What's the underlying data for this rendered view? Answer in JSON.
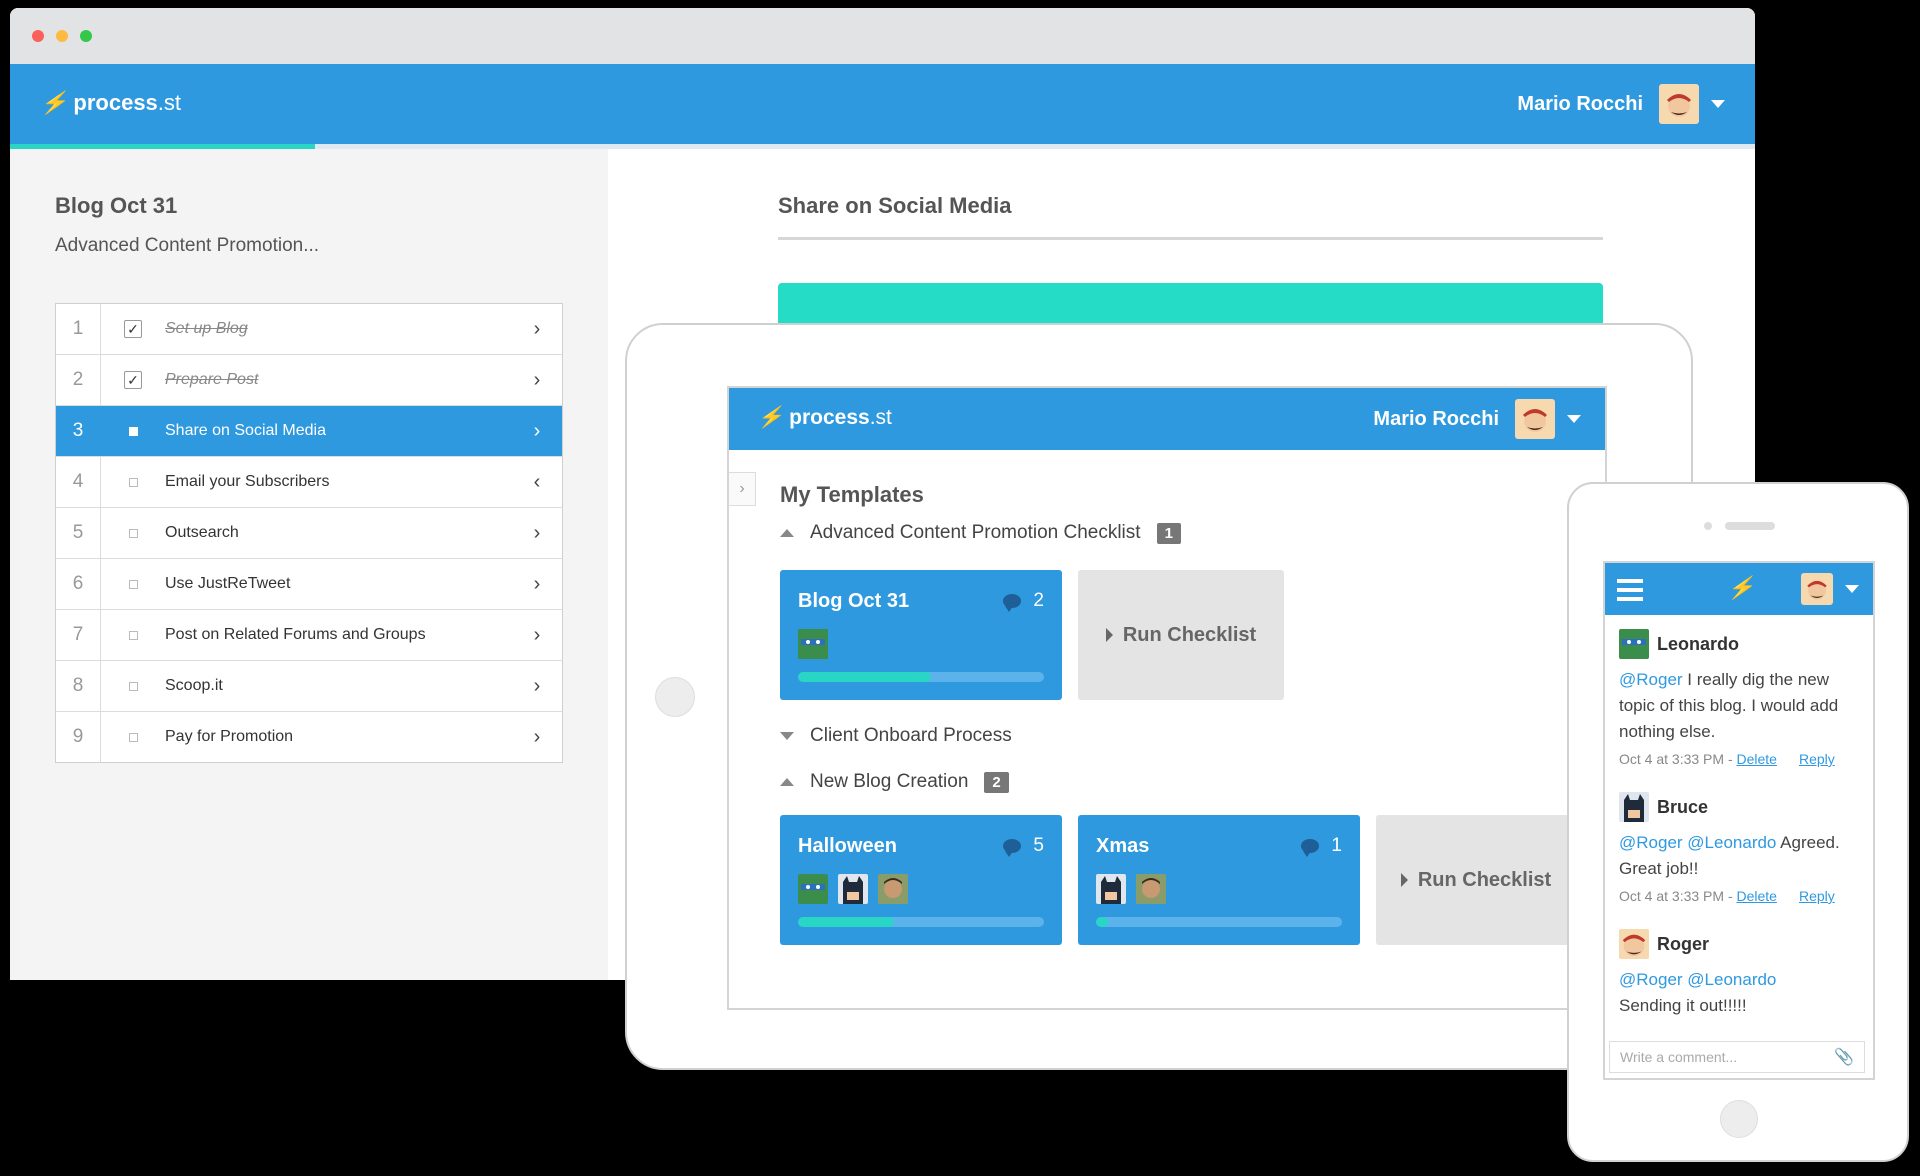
{
  "colors": {
    "brand_blue": "#2f99e0",
    "teal": "#29d6c5",
    "background": "#000000"
  },
  "brand": {
    "logo_icon": "process-street-bolt-icon",
    "name": "process",
    "tld": ".st"
  },
  "user": {
    "name": "Mario Rocchi",
    "avatar_icon": "mario-avatar-icon"
  },
  "desktop": {
    "progress": 0.175,
    "checklist_title": "Blog Oct 31",
    "checklist_subtitle": "Advanced Content Promotion...",
    "tasks": [
      {
        "num": "1",
        "label": "Set up Blog",
        "done": true
      },
      {
        "num": "2",
        "label": "Prepare Post",
        "done": true
      },
      {
        "num": "3",
        "label": "Share on Social Media",
        "active": true
      },
      {
        "num": "4",
        "label": "Email your Subscribers"
      },
      {
        "num": "5",
        "label": "Outsearch"
      },
      {
        "num": "6",
        "label": "Use JustReTweet"
      },
      {
        "num": "7",
        "label": "Post on Related Forums and Groups"
      },
      {
        "num": "8",
        "label": "Scoop.it"
      },
      {
        "num": "9",
        "label": "Pay for Promotion"
      }
    ],
    "task_heading": "Share on Social Media"
  },
  "tablet": {
    "section_title": "My Templates",
    "groups": [
      {
        "name": "Advanced Content Promotion Checklist",
        "count": "1"
      },
      {
        "name": "Client Onboard Process"
      },
      {
        "name": "New Blog Creation",
        "count": "2"
      }
    ],
    "cards": [
      {
        "title": "Blog Oct 31",
        "comments": "2",
        "progress": 0.54
      },
      {
        "title": "Halloween",
        "comments": "5",
        "progress": 0.39
      },
      {
        "title": "Xmas",
        "comments": "1",
        "progress": 0.05
      }
    ],
    "run_checklist": "Run Checklist"
  },
  "phone": {
    "comments": [
      {
        "author": "Leonardo",
        "mention": "@Roger",
        "text": " I really dig the new topic of this blog. I would add nothing else.",
        "time": "Oct 4 at 3:33 PM -",
        "delete": "Delete",
        "reply": "Reply"
      },
      {
        "author": "Bruce",
        "mention": "@Roger @Leonardo",
        "text": " Agreed. Great job!!",
        "time": "Oct 4 at 3:33 PM -",
        "delete": "Delete",
        "reply": "Reply"
      },
      {
        "author": "Roger",
        "mention": "@Roger @Leonardo",
        "text": "Sending it out!!!!!"
      }
    ],
    "comment_placeholder": "Write a comment..."
  }
}
